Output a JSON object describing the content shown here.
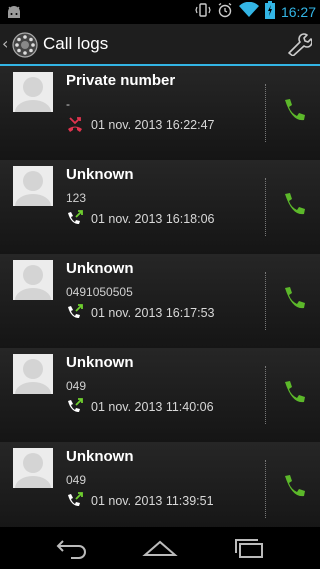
{
  "status_bar": {
    "time": "16:27",
    "icons": [
      "android-icon",
      "vibrate-icon",
      "alarm-icon",
      "wifi-icon",
      "battery-icon"
    ]
  },
  "action_bar": {
    "title": "Call logs",
    "back_icon": "back-chevron-icon",
    "app_icon": "rotary-phone-icon",
    "settings_icon": "wrench-icon"
  },
  "calls": [
    {
      "name": "Private number",
      "number": "-",
      "date": "01 nov. 2013  16:22:47",
      "type": "missed"
    },
    {
      "name": "Unknown",
      "number": "123",
      "date": "01 nov. 2013  16:18:06",
      "type": "outgoing"
    },
    {
      "name": "Unknown",
      "number": "0491050505",
      "date": "01 nov. 2013  16:17:53",
      "type": "outgoing"
    },
    {
      "name": "Unknown",
      "number": "049",
      "date": "01 nov. 2013  11:40:06",
      "type": "outgoing"
    },
    {
      "name": "Unknown",
      "number": "049",
      "date": "01 nov. 2013  11:39:51",
      "type": "outgoing"
    }
  ],
  "nav_bar": {
    "icons": [
      "back-icon",
      "home-icon",
      "recents-icon"
    ]
  },
  "colors": {
    "accent": "#33b5e5",
    "call_green": "#5cb82a",
    "missed_red": "#e0344f",
    "outgoing_green": "#6fcf2f"
  }
}
